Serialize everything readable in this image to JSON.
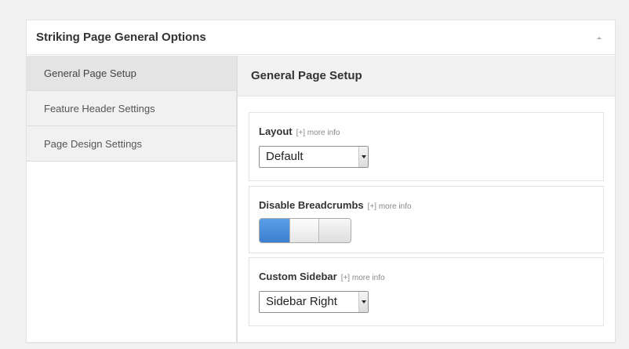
{
  "metabox": {
    "title": "Striking Page General Options"
  },
  "sidebar": {
    "items": [
      {
        "label": "General Page Setup",
        "active": true
      },
      {
        "label": "Feature Header Settings",
        "active": false
      },
      {
        "label": "Page Design Settings",
        "active": false
      }
    ]
  },
  "content": {
    "heading": "General Page Setup",
    "options": {
      "layout": {
        "label": "Layout",
        "more_info": "[+] more info",
        "selected": "Default"
      },
      "breadcrumbs": {
        "label": "Disable Breadcrumbs",
        "more_info": "[+] more info",
        "toggle_state": "off"
      },
      "sidebar": {
        "label": "Custom Sidebar",
        "more_info": "[+] more info",
        "selected": "Sidebar Right"
      }
    }
  },
  "icons": {
    "collapse": "chevron-up-icon",
    "select_arrow": "caret-down-icon"
  },
  "colors": {
    "accent": "#4a8ddc",
    "panel_bg": "#f1f1f1",
    "active_tab": "#e4e4e4"
  }
}
